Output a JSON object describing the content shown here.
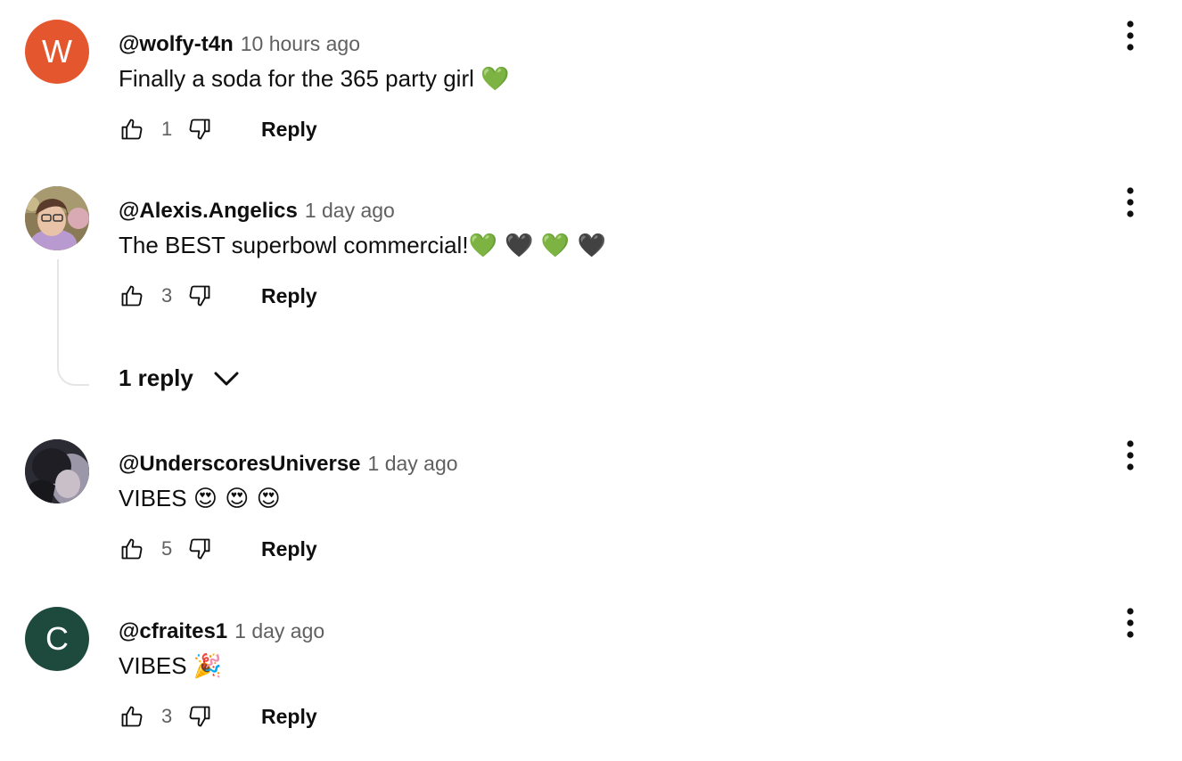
{
  "colors": {
    "avatar_w": "#e4572e",
    "avatar_c": "#1d4a3c",
    "text_primary": "#0f0f0f",
    "text_secondary": "#606060",
    "thread_line": "#e5e5e5"
  },
  "actions": {
    "reply_label": "Reply"
  },
  "comments": [
    {
      "author": "@wolfy-t4n",
      "time": "10 hours ago",
      "text": "Finally a soda for the 365 party girl",
      "emoji": "💚",
      "likes": "1",
      "avatar_letter": "W"
    },
    {
      "author": "@Alexis.Angelics",
      "time": "1 day ago",
      "text": "The BEST superbowl commercial!",
      "emoji": "💚 🖤 💚 🖤",
      "likes": "3",
      "replies_label": "1 reply"
    },
    {
      "author": "@UnderscoresUniverse",
      "time": "1 day ago",
      "text": "VIBES",
      "emoji": "😍 😍 😍",
      "likes": "5"
    },
    {
      "author": "@cfraites1",
      "time": "1 day ago",
      "text": "VIBES",
      "emoji": "🎉",
      "likes": "3",
      "avatar_letter": "C"
    }
  ]
}
